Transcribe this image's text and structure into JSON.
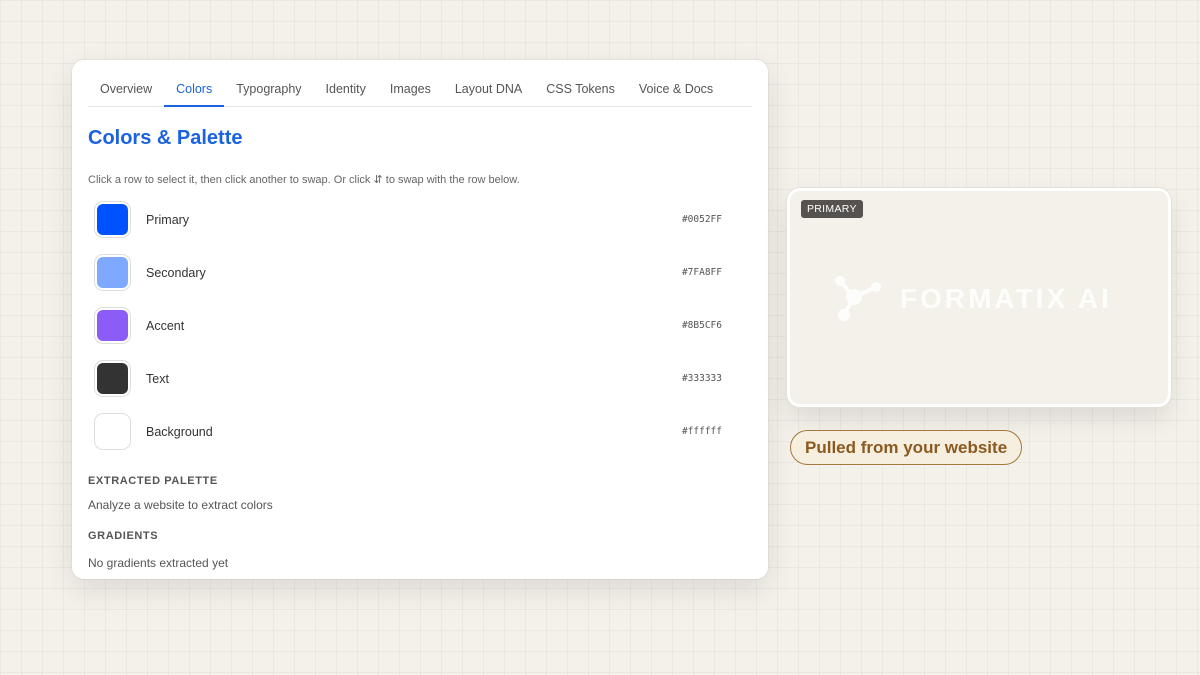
{
  "tabs": [
    {
      "label": "Overview"
    },
    {
      "label": "Colors",
      "active": true
    },
    {
      "label": "Typography"
    },
    {
      "label": "Identity"
    },
    {
      "label": "Images"
    },
    {
      "label": "Layout DNA"
    },
    {
      "label": "CSS Tokens"
    },
    {
      "label": "Voice & Docs"
    }
  ],
  "panel": {
    "title": "Colors & Palette",
    "hint": "Click a row to select it, then click another to swap. Or click ⇵ to swap with the row below."
  },
  "colors": [
    {
      "label": "Primary",
      "hex": "#0052FF",
      "color": "#0052FF"
    },
    {
      "label": "Secondary",
      "hex": "#7FA8FF",
      "color": "#7FA8FF"
    },
    {
      "label": "Accent",
      "hex": "#8B5CF6",
      "color": "#8B5CF6"
    },
    {
      "label": "Text",
      "hex": "#333333",
      "color": "#333333"
    },
    {
      "label": "Background",
      "hex": "#ffffff",
      "color": "#ffffff"
    }
  ],
  "extracted": {
    "heading": "EXTRACTED PALETTE",
    "text": "Analyze a website to extract colors"
  },
  "gradients": {
    "heading": "GRADIENTS",
    "text": "No gradients extracted yet"
  },
  "preview": {
    "badge": "PRIMARY",
    "logo_text": "FORMATIX AI",
    "logo_icon": "molecule-icon"
  },
  "caption": "Pulled from your website",
  "theme": {
    "accent": "#1a63e0",
    "background": "#f4f1ea",
    "caption_color": "#8a5a20"
  }
}
